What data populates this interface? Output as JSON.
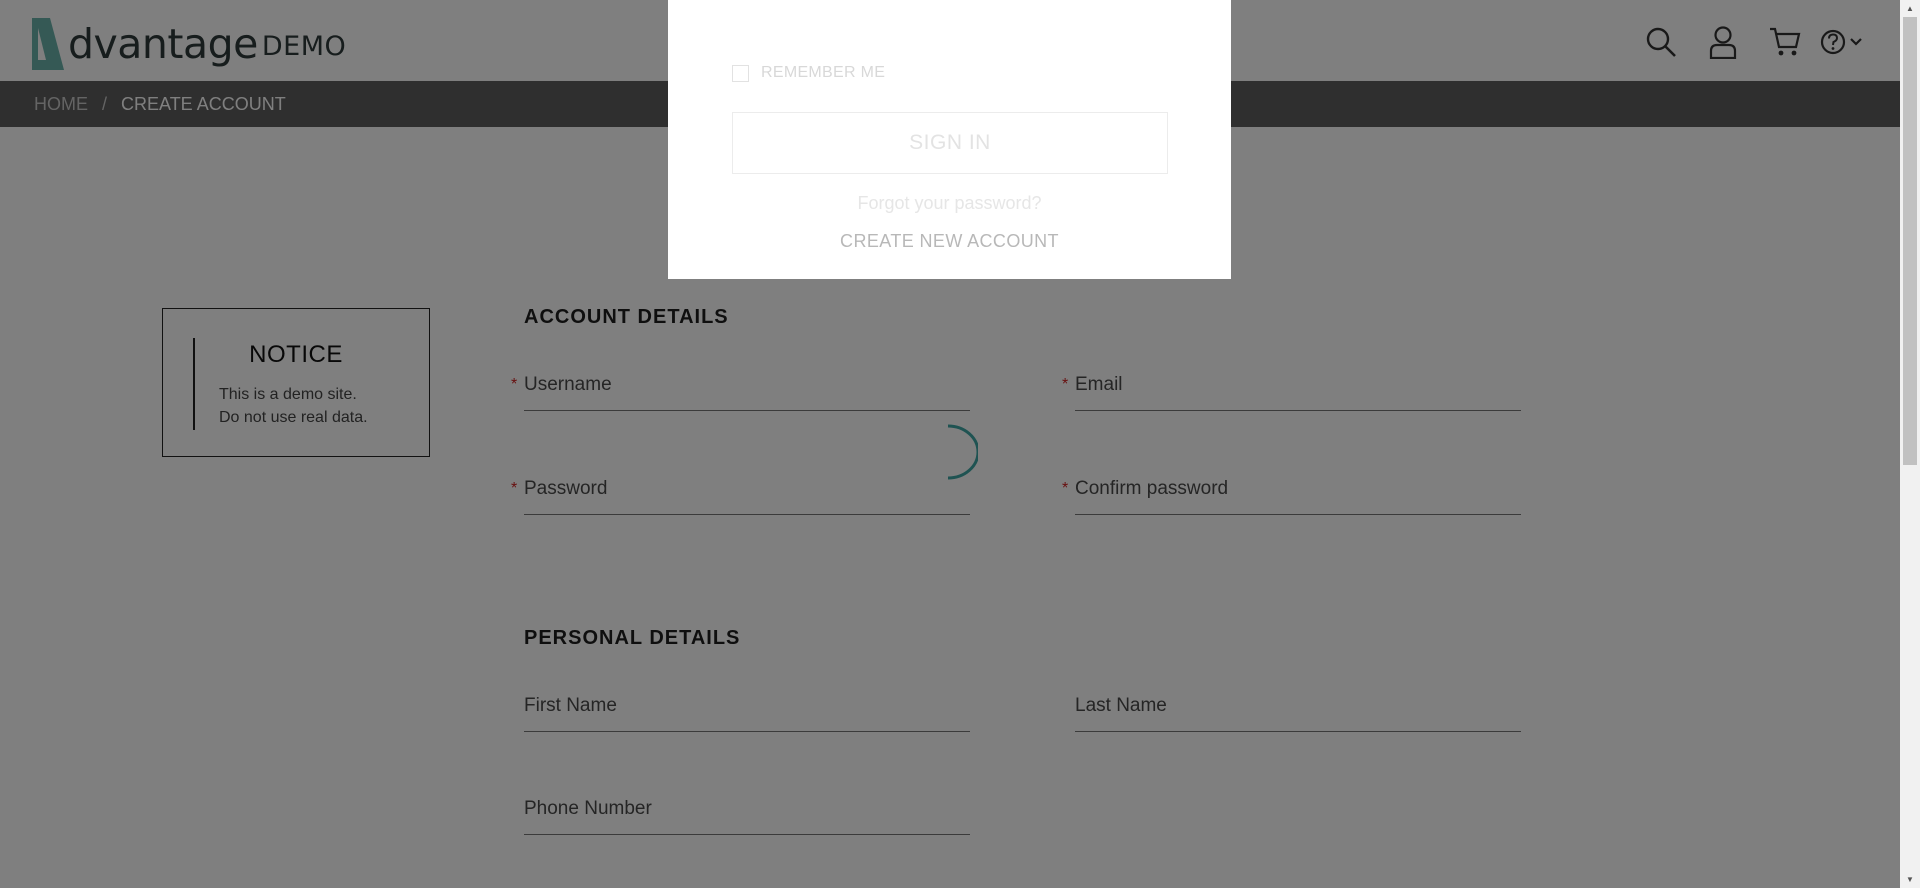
{
  "brand": {
    "logo_letter": "A",
    "word": "dvantage",
    "demo": "DEMO",
    "accent_color": "#6bb3aa"
  },
  "nav": {
    "icons": [
      "search-icon",
      "user-icon",
      "cart-icon",
      "help-icon",
      "chevron-down-icon"
    ]
  },
  "breadcrumb": {
    "home": "HOME",
    "separator": "/",
    "current": "CREATE ACCOUNT"
  },
  "notice": {
    "title": "NOTICE",
    "line1": "This is a demo site.",
    "line2": "Do not use real data."
  },
  "account_details": {
    "title": "ACCOUNT DETAILS",
    "username_placeholder": "Username",
    "email_placeholder": "Email",
    "password_placeholder": "Password",
    "confirm_password_placeholder": "Confirm password",
    "required_mark": "*"
  },
  "personal_details": {
    "title": "PERSONAL DETAILS",
    "first_name_placeholder": "First Name",
    "last_name_placeholder": "Last Name",
    "phone_placeholder": "Phone Number"
  },
  "login_modal": {
    "remember_me": "REMEMBER ME",
    "sign_in": "SIGN IN",
    "forgot": "Forgot your password?",
    "create_new": "CREATE NEW ACCOUNT"
  },
  "colors": {
    "breadcrumb_bg": "#5e5e5e",
    "required": "#d02020",
    "spinner": "#3fa7a5"
  }
}
